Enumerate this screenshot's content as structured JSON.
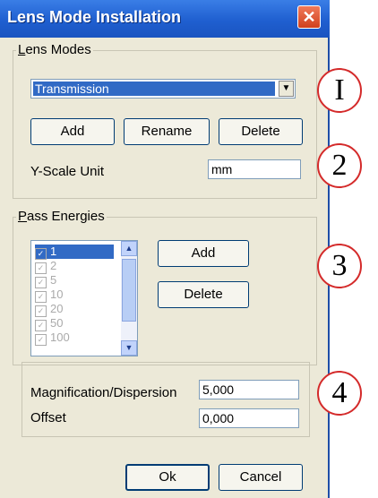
{
  "window": {
    "title": "Lens Mode Installation",
    "close_glyph": "✕"
  },
  "lens_modes": {
    "group_label_first": "L",
    "group_label_rest": "ens Modes",
    "selected_mode": "Transmission",
    "add_label": "Add",
    "rename_label": "Rename",
    "delete_label": "Delete",
    "y_scale_label": "Y-Scale Unit",
    "y_scale_value": "mm"
  },
  "pass_energies": {
    "group_label_first": "P",
    "group_label_rest": "ass Energies",
    "items": [
      "1",
      "2",
      "5",
      "10",
      "20",
      "50",
      "100"
    ],
    "selected_index": 0,
    "add_label": "Add",
    "delete_label": "Delete"
  },
  "calibration": {
    "magnification_label": "Magnification/Dispersion",
    "magnification_value": "5,000",
    "offset_label": "Offset",
    "offset_value": "0,000"
  },
  "footer": {
    "ok_label": "Ok",
    "cancel_label": "Cancel"
  },
  "callouts": [
    "I",
    "2",
    "3",
    "4"
  ]
}
